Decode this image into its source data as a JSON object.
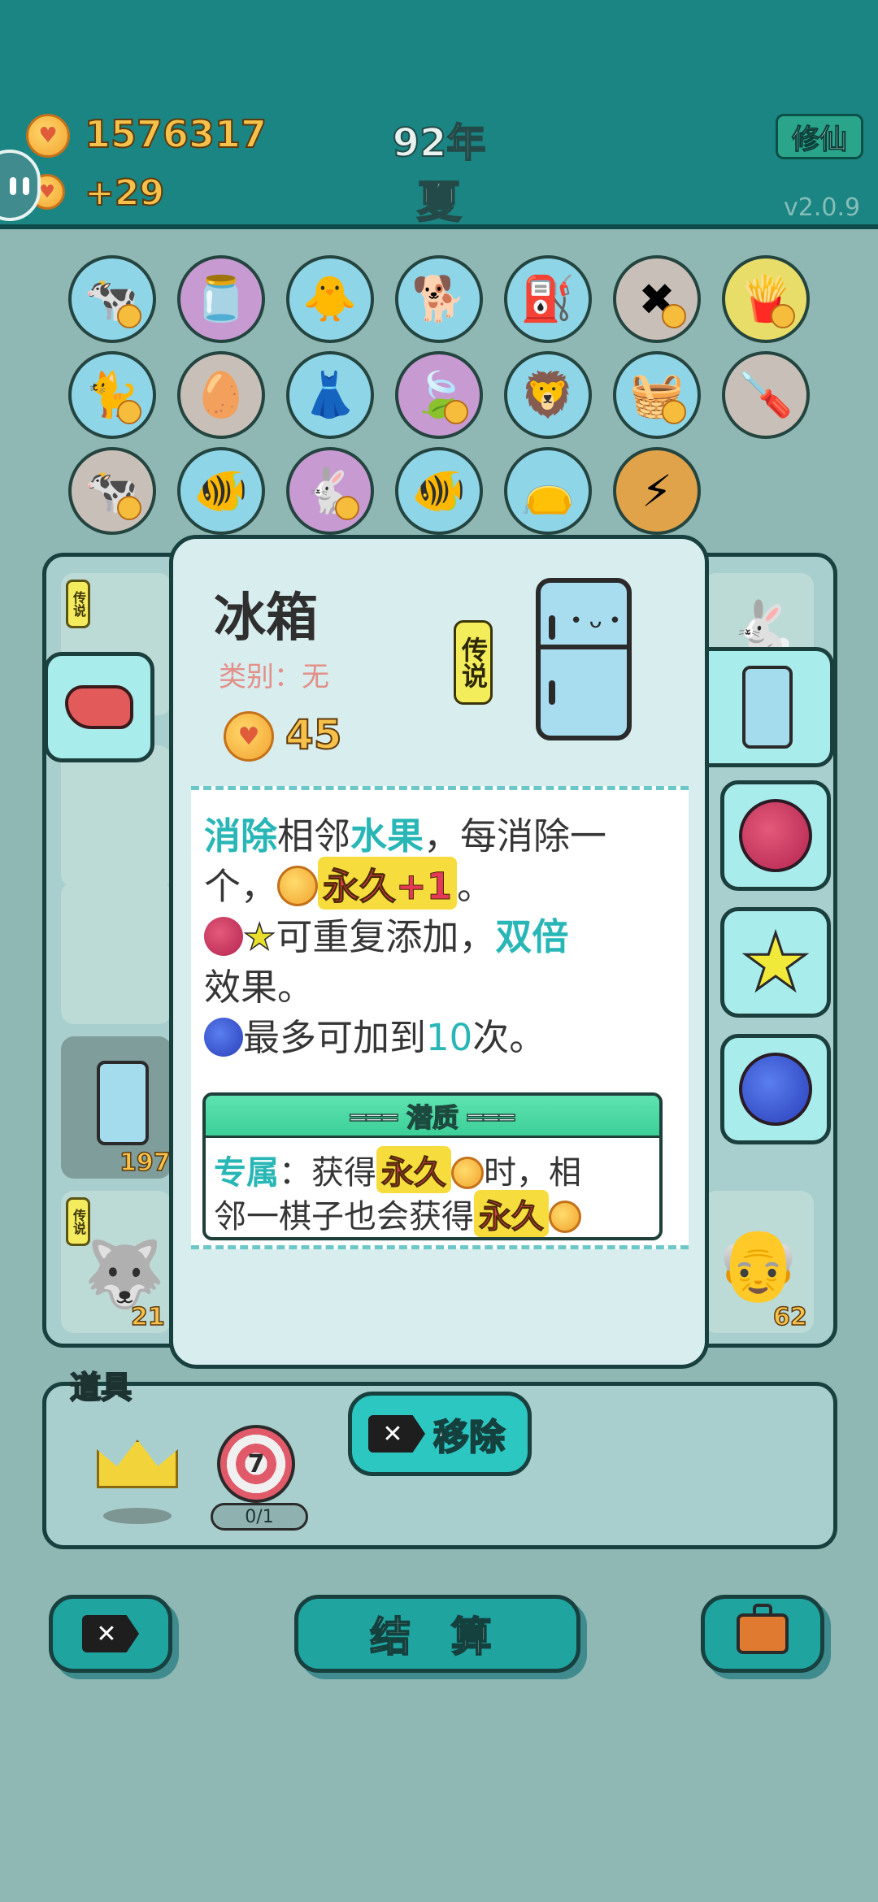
{
  "header": {
    "coins": "1576317",
    "income": "+29",
    "year": "92年",
    "season": "夏",
    "xiuxian_label": "修仙",
    "version": "v2.0.9"
  },
  "board": {
    "tile_badge": "传说",
    "tile_numbers": [
      "197",
      "21",
      "62"
    ]
  },
  "modal": {
    "title": "冰箱",
    "category": "类别：无",
    "legend_tag": "传说",
    "coin_value": "45",
    "desc": {
      "l1_a": "消除",
      "l1_b": "相邻",
      "l1_c": "水果",
      "l1_d": "，每消除一",
      "l2_a": "个，",
      "l2_perm": "永久+1",
      "l2_end": "。",
      "l3_a": "可重复添加，",
      "l3_b": "双倍",
      "l4": "效果。",
      "l5_a": "最多可加到",
      "l5_b": "10",
      "l5_c": "次。"
    },
    "potential": {
      "heading": "═══ 潜质 ═══",
      "l1_label": "专属",
      "l1_a": "：获得",
      "l1_perm": "永久",
      "l1_b": "时，相",
      "l2_a": "邻一棋子也会获得",
      "l2_perm": "永久"
    }
  },
  "items": {
    "label": "道具",
    "dart_number": "7",
    "dart_count": "0/1",
    "remove_label": "移除"
  },
  "footer": {
    "settle_label": "结 算"
  },
  "colors": {
    "topbar": "#1a8583",
    "accent_teal": "#28b6b6",
    "permanent_red": "#e43a57",
    "gold": "#f6c14b"
  },
  "icons": {
    "coin": "heart-coin-icon",
    "remove": "x-tag-icon",
    "briefcase": "briefcase-icon",
    "crown": "crown-icon",
    "dart": "dartboard-icon"
  }
}
